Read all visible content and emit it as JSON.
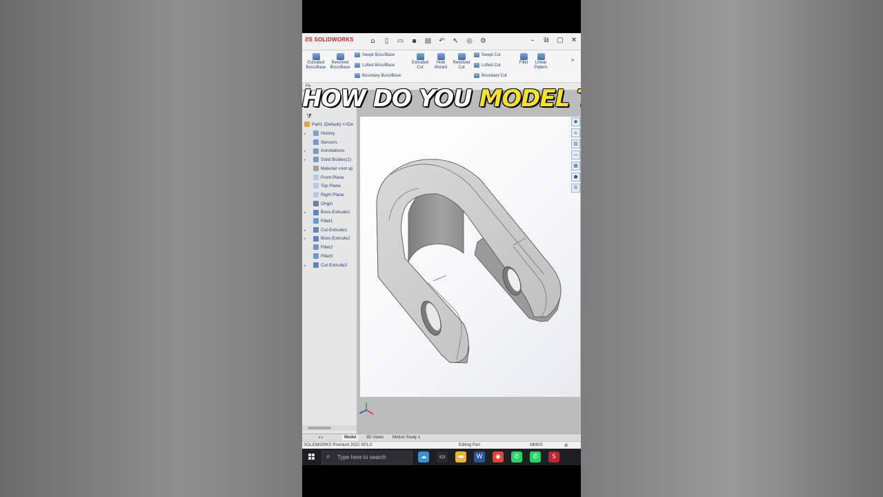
{
  "overlay_caption": {
    "part1": "HOW DO YOU",
    "part2": "MODEL THIS"
  },
  "app": {
    "logo_text": "SOLIDWORKS",
    "quick_access_icons": [
      "home-icon",
      "new-file-icon",
      "open-icon",
      "save-icon",
      "print-icon",
      "undo-icon",
      "select-arrow-icon",
      "rebuild-icon",
      "options-icon",
      "help-icon"
    ],
    "window_controls": [
      "minimize",
      "restore",
      "maximize",
      "close"
    ],
    "ribbon": {
      "extruded_boss": "Extruded Boss/Base",
      "revolved_boss": "Revolved Boss/Base",
      "swept_boss": "Swept Boss/Base",
      "lofted_boss": "Lofted Boss/Base",
      "boundary_boss": "Boundary Boss/Base",
      "extruded_cut": "Extruded Cut",
      "hole_wizard": "Hole Wizard",
      "revolved_cut": "Revolved Cut",
      "swept_cut": "Swept Cut",
      "lofted_cut": "Lofted Cut",
      "boundary_cut": "Boundary Cut",
      "fillet": "Fillet",
      "linear_pattern": "Linear Pattern"
    },
    "command_tab": "Fe",
    "tree": {
      "root": "Part1 (Default) <<De",
      "items": [
        {
          "label": "History",
          "icon": "history-icon",
          "color": "#8aa0c0",
          "expand": "▸"
        },
        {
          "label": "Sensors",
          "icon": "sensors-icon",
          "color": "#7d9ac2",
          "expand": ""
        },
        {
          "label": "Annotations",
          "icon": "annotations-icon",
          "color": "#7d9ac2",
          "expand": "▸"
        },
        {
          "label": "Solid Bodies(1)",
          "icon": "solid-bodies-icon",
          "color": "#7d9ac2",
          "expand": "▸"
        },
        {
          "label": "Material <not sp",
          "icon": "material-icon",
          "color": "#a0a0a0",
          "expand": ""
        },
        {
          "label": "Front Plane",
          "icon": "plane-icon",
          "color": "#b9c9e0",
          "expand": ""
        },
        {
          "label": "Top Plane",
          "icon": "plane-icon",
          "color": "#b9c9e0",
          "expand": ""
        },
        {
          "label": "Right Plane",
          "icon": "plane-icon",
          "color": "#b9c9e0",
          "expand": ""
        },
        {
          "label": "Origin",
          "icon": "origin-icon",
          "color": "#6b7f9e",
          "expand": ""
        },
        {
          "label": "Boss-Extrude1",
          "icon": "boss-extrude-icon",
          "color": "#5f86c0",
          "expand": "▸"
        },
        {
          "label": "Fillet1",
          "icon": "fillet-icon",
          "color": "#6f97cf",
          "expand": ""
        },
        {
          "label": "Cut-Extrude1",
          "icon": "cut-extrude-icon",
          "color": "#5f86c0",
          "expand": "▸"
        },
        {
          "label": "Boss-Extrude2",
          "icon": "boss-extrude-icon",
          "color": "#5f86c0",
          "expand": "▸"
        },
        {
          "label": "Fillet2",
          "icon": "fillet-icon",
          "color": "#6f97cf",
          "expand": ""
        },
        {
          "label": "Fillet3",
          "icon": "fillet-icon",
          "color": "#6f97cf",
          "expand": ""
        },
        {
          "label": "Cut-Extrude2",
          "icon": "cut-extrude-icon",
          "color": "#5f86c0",
          "expand": "▸"
        }
      ]
    },
    "bottom_tabs": [
      "Model",
      "3D Views",
      "Motion Study 1"
    ],
    "active_bottom_tab": "Model",
    "status": {
      "version": "SOLIDWORKS Premium 2022 SP1.0",
      "mode": "Editing Part",
      "units": "MMGS"
    }
  },
  "taskbar": {
    "search_placeholder": "Type here to search",
    "apps": [
      {
        "name": "weather-icon",
        "color": "#3a8fd9",
        "glyph": "☁"
      },
      {
        "name": "task-view-icon",
        "color": "#2a2b30",
        "glyph": "▭"
      },
      {
        "name": "file-explorer-icon",
        "color": "#e8b534",
        "glyph": "▬"
      },
      {
        "name": "word-icon",
        "color": "#2b579a",
        "glyph": "W"
      },
      {
        "name": "chrome-icon",
        "color": "#db4437",
        "glyph": "◉"
      },
      {
        "name": "whatsapp-icon",
        "color": "#25d366",
        "glyph": "✆"
      },
      {
        "name": "whatsapp-business-icon",
        "color": "#25d366",
        "glyph": "✆"
      },
      {
        "name": "solidworks-icon",
        "color": "#c0262d",
        "glyph": "S"
      }
    ]
  },
  "colors": {
    "caption_white": "#ffffff",
    "caption_yellow": "#f2e32a",
    "brand_red": "#d62020",
    "feature_blue": "#2a3f6e"
  }
}
